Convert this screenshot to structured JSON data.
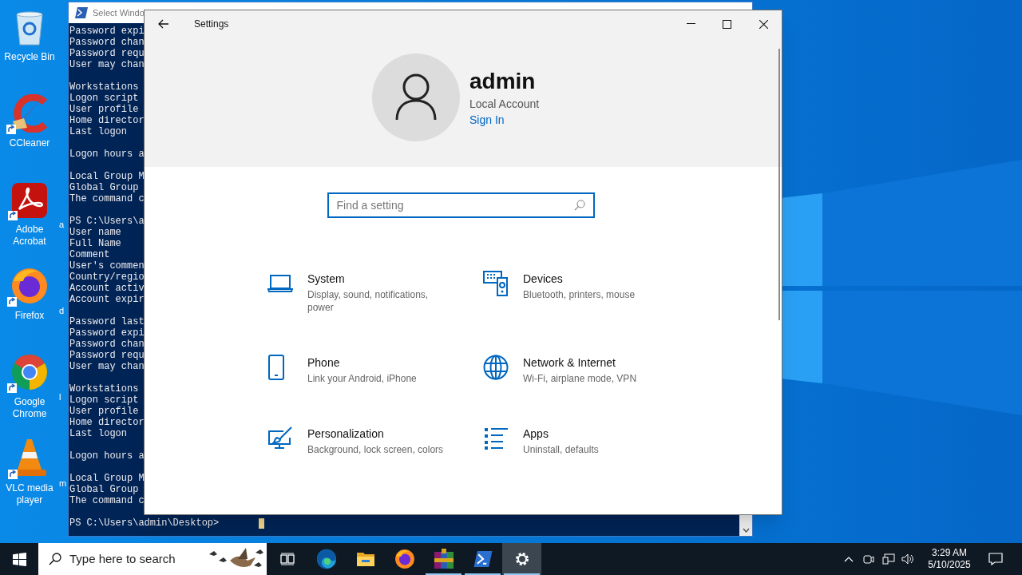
{
  "desktop_icons": [
    {
      "label": "Recycle Bin",
      "kind": "recycle-bin",
      "shortcut": false
    },
    {
      "label": "CCleaner",
      "kind": "ccleaner",
      "shortcut": true
    },
    {
      "label": "Adobe Acrobat",
      "kind": "acrobat",
      "shortcut": true
    },
    {
      "label": "Firefox",
      "kind": "firefox",
      "shortcut": true
    },
    {
      "label": "Google Chrome",
      "kind": "chrome",
      "shortcut": true
    },
    {
      "label": "VLC media player",
      "kind": "vlc",
      "shortcut": true
    }
  ],
  "cut_icon_labels": [
    "a",
    "d",
    "l",
    "m"
  ],
  "console": {
    "title": "Select Windo",
    "blocks": [
      [
        "Password expi",
        "Password chan",
        "Password requ",
        "User may chan"
      ],
      [
        "Workstations",
        "Logon script",
        "User profile",
        "Home director",
        "Last logon"
      ],
      [
        "Logon hours a"
      ],
      [
        "Local Group M",
        "Global Group",
        "The command c"
      ],
      [
        "PS C:\\Users\\a",
        "User name",
        "Full Name",
        "Comment",
        "User's commen",
        "Country/regio",
        "Account activ",
        "Account expir"
      ],
      [
        "Password last",
        "Password expi",
        "Password chan",
        "Password requ",
        "User may chan"
      ],
      [
        "Workstations",
        "Logon script",
        "User profile",
        "Home director",
        "Last logon"
      ],
      [
        "Logon hours a"
      ],
      [
        "Local Group M",
        "Global Group",
        "The command c"
      ]
    ],
    "prompt": "PS C:\\Users\\admin\\Desktop>"
  },
  "settings": {
    "title": "Settings",
    "account": {
      "name": "admin",
      "type": "Local Account",
      "link": "Sign In"
    },
    "search": {
      "placeholder": "Find a setting"
    },
    "categories": [
      {
        "kind": "system",
        "title": "System",
        "subtitle": "Display, sound, notifications, power"
      },
      {
        "kind": "devices",
        "title": "Devices",
        "subtitle": "Bluetooth, printers, mouse"
      },
      {
        "kind": "phone",
        "title": "Phone",
        "subtitle": "Link your Android, iPhone"
      },
      {
        "kind": "network",
        "title": "Network & Internet",
        "subtitle": "Wi-Fi, airplane mode, VPN"
      },
      {
        "kind": "personalization",
        "title": "Personalization",
        "subtitle": "Background, lock screen, colors"
      },
      {
        "kind": "apps",
        "title": "Apps",
        "subtitle": "Uninstall, defaults"
      }
    ]
  },
  "taskbar": {
    "search_placeholder": "Type here to search",
    "apps": [
      {
        "kind": "task-view",
        "running": false,
        "selected": false
      },
      {
        "kind": "edge",
        "running": false,
        "selected": false
      },
      {
        "kind": "explorer",
        "running": false,
        "selected": false
      },
      {
        "kind": "firefox",
        "running": false,
        "selected": false
      },
      {
        "kind": "winrar",
        "running": true,
        "selected": false
      },
      {
        "kind": "powershell",
        "running": true,
        "selected": false
      },
      {
        "kind": "settings",
        "running": true,
        "selected": true
      }
    ],
    "clock": {
      "time": "3:29 AM",
      "date": "5/10/2025"
    }
  }
}
